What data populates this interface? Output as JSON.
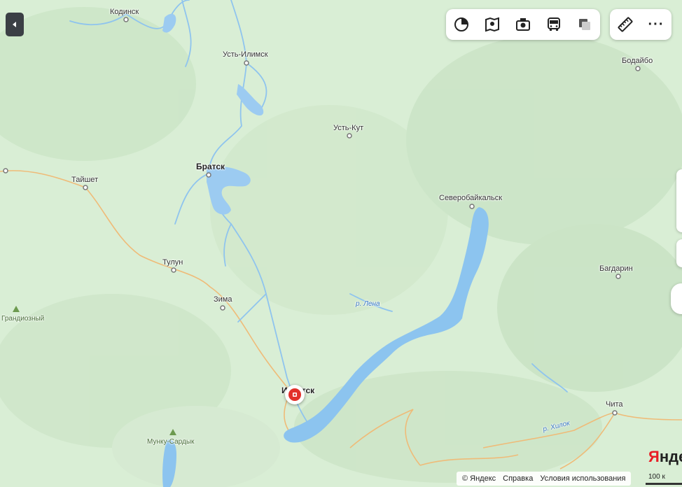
{
  "map": {
    "colors": {
      "land": "#d7ecd3",
      "forest": "#c7e2c2",
      "water": "#8cc3ef",
      "road": "#f0b870",
      "river": "#8fc4ee"
    },
    "cities": [
      {
        "id": "kodinsk",
        "name": "Кодинск",
        "bold": false
      },
      {
        "id": "ust-ilimsk",
        "name": "Усть-Илимск",
        "bold": false
      },
      {
        "id": "bodaibo",
        "name": "Бодайбо",
        "bold": false
      },
      {
        "id": "ust-kut",
        "name": "Усть-Кут",
        "bold": false
      },
      {
        "id": "bratsk",
        "name": "Братск",
        "bold": true
      },
      {
        "id": "taishet",
        "name": "Тайшет",
        "bold": false
      },
      {
        "id": "severobaikalsk",
        "name": "Северобайкальск",
        "bold": false
      },
      {
        "id": "tulun",
        "name": "Тулун",
        "bold": false
      },
      {
        "id": "bagdarin",
        "name": "Багдарин",
        "bold": false
      },
      {
        "id": "zima",
        "name": "Зима",
        "bold": false
      },
      {
        "id": "irkutsk",
        "name": "Иркутск",
        "bold": true
      },
      {
        "id": "chita",
        "name": "Чита",
        "bold": false
      }
    ],
    "rivers": [
      {
        "id": "lena",
        "name": "р. Лена"
      },
      {
        "id": "khilok",
        "name": "р. Хилок"
      }
    ],
    "peaks": [
      {
        "id": "grandiozny",
        "name": "Грандиозный"
      },
      {
        "id": "munku-sardyk",
        "name": "Мунку-Сардык"
      }
    ]
  },
  "toolbar": {
    "layers_icon": "layers-icon",
    "panorama_icon": "panorama-icon",
    "photo_icon": "camera-icon",
    "transit_icon": "bus-icon",
    "overlay_icon": "square-layers-icon",
    "ruler_icon": "ruler-icon",
    "more_icon": "more-icon",
    "more_label": "···"
  },
  "collapse": {
    "icon": "chevron-left-icon",
    "label": "◂"
  },
  "attribution": {
    "copyright": "© Яндекс",
    "help": "Справка",
    "terms": "Условия использования"
  },
  "scale": {
    "label": "100 к"
  },
  "brand": {
    "text_y": "Я",
    "text_rest": "нде"
  }
}
